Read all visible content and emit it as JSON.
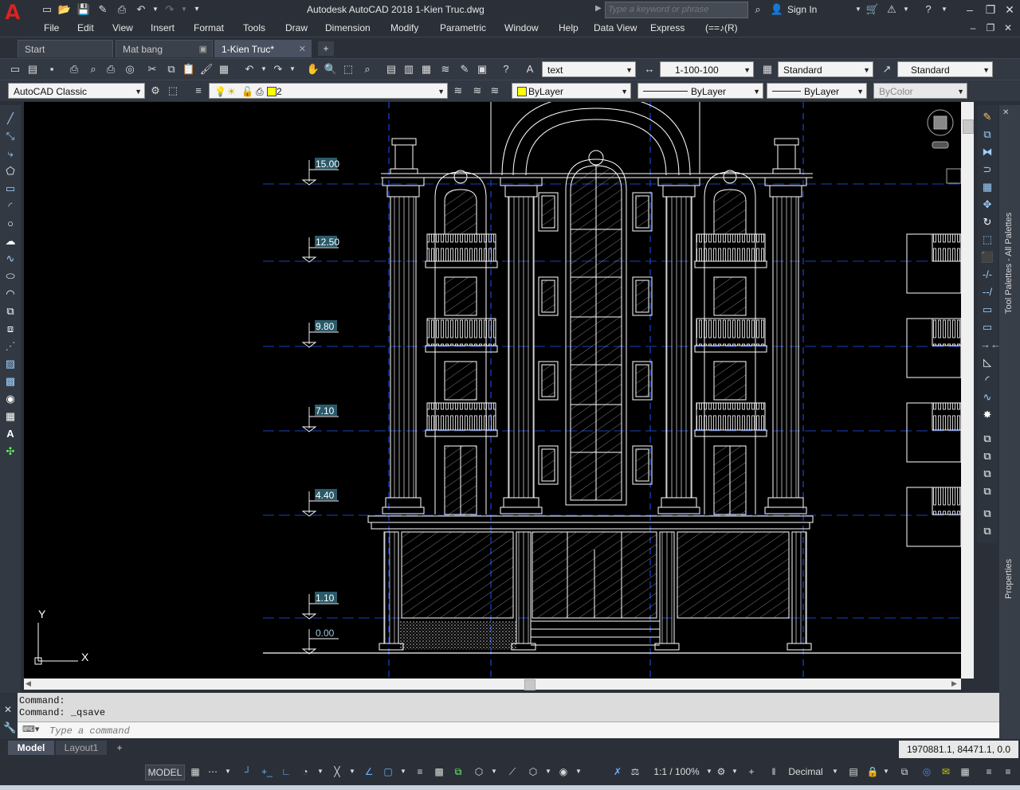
{
  "app": {
    "title": "Autodesk AutoCAD 2018   1-Kien Truc.dwg",
    "search_placeholder": "Type a keyword or phrase",
    "sign_in": "Sign In",
    "logo_letter": "A"
  },
  "menus": [
    "File",
    "Edit",
    "View",
    "Insert",
    "Format",
    "Tools",
    "Draw",
    "Dimension",
    "Modify",
    "Parametric",
    "Window",
    "Help",
    "Data View",
    "Express",
    "(==♪(R)"
  ],
  "tabs": [
    {
      "label": "Start"
    },
    {
      "label": "Mat bang"
    },
    {
      "label": "1-Kien Truc*"
    }
  ],
  "toolbar1": {
    "text_style": "text",
    "dim_scale": "1-100-100",
    "table_style": "Standard",
    "mleader_style": "Standard"
  },
  "toolbar2": {
    "workspace": "AutoCAD Classic",
    "layer": "2",
    "color": "ByLayer",
    "linetype": "ByLayer",
    "lineweight": "ByLayer",
    "plotstyle": "ByColor"
  },
  "drawing": {
    "elevations": [
      "15.00",
      "12.50",
      "9.80",
      "7.10",
      "4.40",
      "1.10",
      "0.00"
    ],
    "ucs_x": "X",
    "ucs_y": "Y"
  },
  "palettes": {
    "tool_palettes": "Tool Palettes - All Palettes",
    "properties": "Properties"
  },
  "command": {
    "line1": "Command:",
    "line2": "Command: _qsave",
    "placeholder": "Type a command"
  },
  "layout_tabs": [
    "Model",
    "Layout1"
  ],
  "status": {
    "coordinates": "1970881.1, 84471.1, 0.0",
    "model": "MODEL",
    "annotation_scale": "1:1 / 100%",
    "units": "Decimal"
  },
  "colors": {
    "canvas": "#000000",
    "line": "#ffffff",
    "level_line": "#1a3fbf",
    "grid_line": "#2050ff",
    "chrome": "#2b3038",
    "layer_color_swatch": "#ffff00"
  }
}
